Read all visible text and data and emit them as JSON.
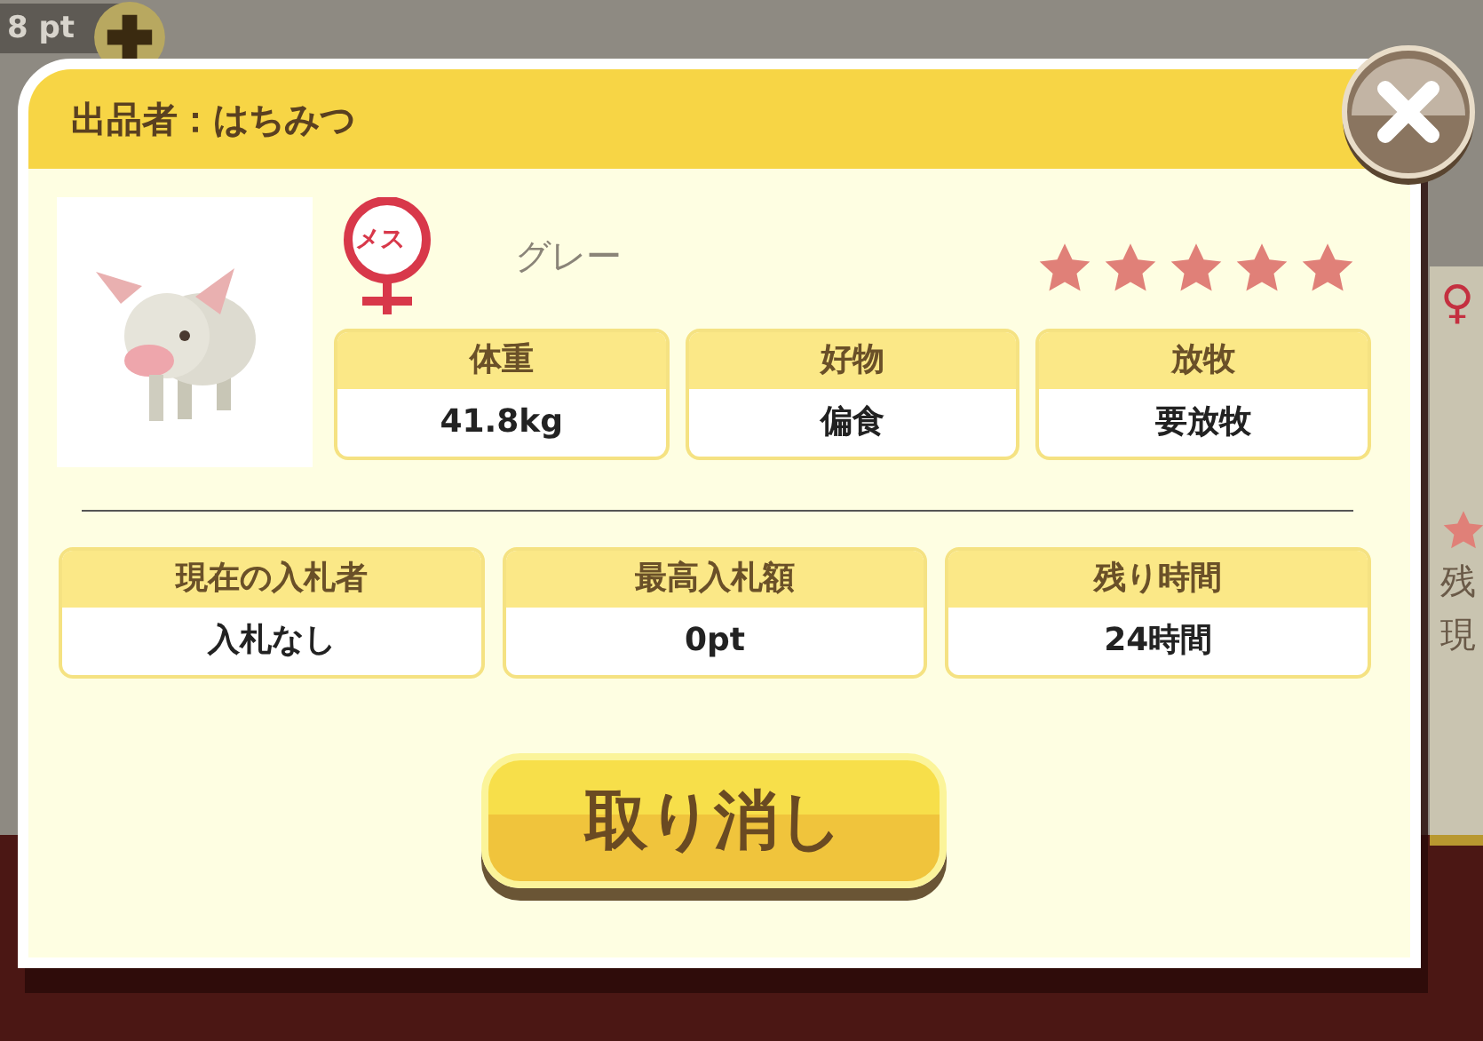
{
  "background": {
    "points": "8 pt",
    "side_card": {
      "gender": "♀",
      "labels": [
        "残",
        "現"
      ]
    }
  },
  "dialog": {
    "seller": "出品者：はちみつ",
    "sex": {
      "kind": "female",
      "label": "メス"
    },
    "color_name": "グレー",
    "stars": 5,
    "stats": [
      {
        "label": "体重",
        "value": "41.8kg"
      },
      {
        "label": "好物",
        "value": "偏食"
      },
      {
        "label": "放牧",
        "value": "要放牧"
      }
    ],
    "auction": [
      {
        "label": "現在の入札者",
        "value": "入札なし"
      },
      {
        "label": "最高入札額",
        "value": "0pt"
      },
      {
        "label": "残り時間",
        "value": "24時間"
      }
    ],
    "button": "取り消し"
  }
}
